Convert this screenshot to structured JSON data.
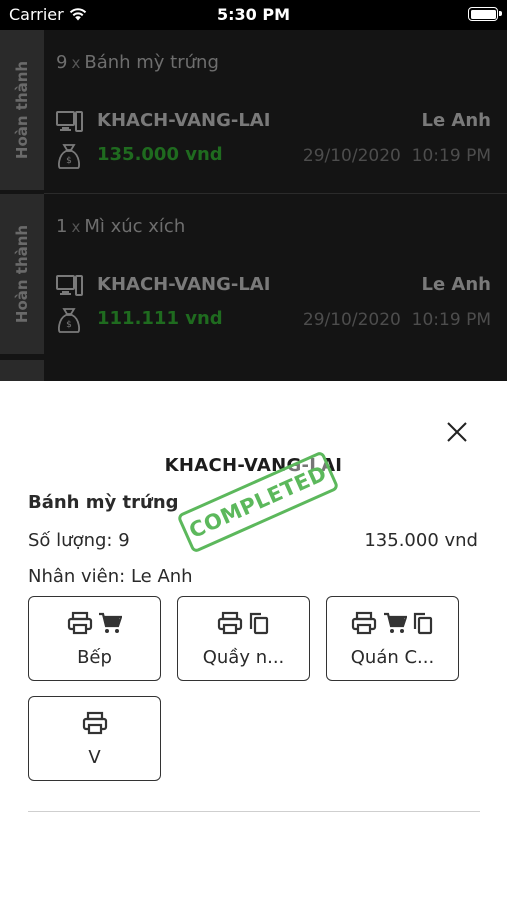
{
  "status_bar": {
    "carrier": "Carrier",
    "time": "5:30 PM"
  },
  "orders": [
    {
      "status": "Hoàn thành",
      "quantity": "9",
      "x": "x",
      "item": "Bánh mỳ trứng",
      "customer": "KHACH-VANG-LAI",
      "staff": "Le Anh",
      "price": "135.000 vnd",
      "date": "29/10/2020",
      "time": "10:19 PM"
    },
    {
      "status": "Hoàn thành",
      "quantity": "1",
      "x": "x",
      "item": "Mì xúc xích",
      "customer": "KHACH-VANG-LAI",
      "staff": "Le Anh",
      "price": "111.111 vnd",
      "date": "29/10/2020",
      "time": "10:19 PM"
    }
  ],
  "sheet": {
    "title": "KHACH-VANG-LAI",
    "item_name": "Bánh mỳ trứng",
    "quantity_label": "Số lượng: 9",
    "total": "135.000 vnd",
    "staff_label": "Nhân viên: Le Anh",
    "stamp": "COMPLETED",
    "printers": [
      {
        "label": "Bếp",
        "icons": [
          "printer-icon",
          "cart-icon"
        ]
      },
      {
        "label": "Quầy n...",
        "icons": [
          "printer-icon",
          "copy-icon"
        ]
      },
      {
        "label": "Quán C...",
        "icons": [
          "printer-icon",
          "cart-icon",
          "copy-icon"
        ]
      },
      {
        "label": "V",
        "icons": [
          "printer-icon"
        ]
      }
    ]
  },
  "colors": {
    "list_background": "#141414",
    "status_column": "#2a2a2a",
    "price_green": "#1f6b1f",
    "stamp_green": "#5cb85c"
  }
}
